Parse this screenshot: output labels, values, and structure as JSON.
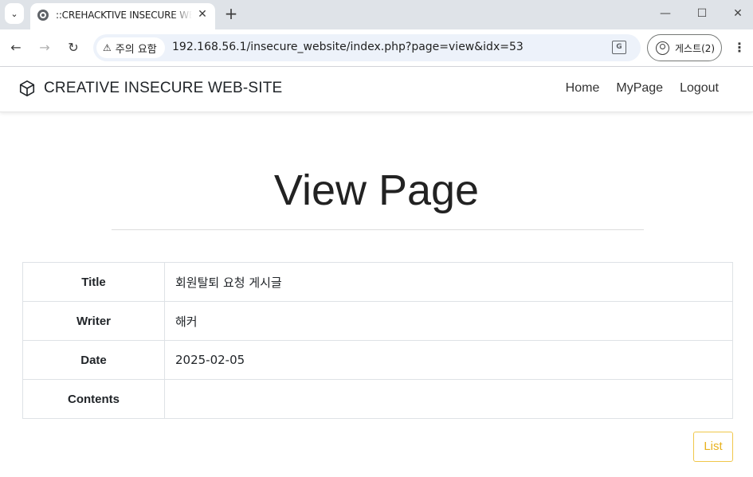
{
  "browser": {
    "tab_title": "::CREHACKTIVE INSECURE WEBSITE::",
    "new_tab_label": "+",
    "security_label": "주의 요함",
    "url": "192.168.56.1/insecure_website/index.php?page=view&idx=53",
    "profile_label": "게스트(2)",
    "icons": [
      "tab-search-icon",
      "globe-icon",
      "close-icon",
      "plus-icon",
      "minimize-icon",
      "maximize-icon",
      "window-close-icon",
      "back-icon",
      "forward-icon",
      "reload-icon",
      "warning-icon",
      "translate-icon",
      "person-icon",
      "more-vert-icon"
    ]
  },
  "site": {
    "brand": "CREATIVE INSECURE WEB-SITE",
    "nav": [
      {
        "label": "Home"
      },
      {
        "label": "MyPage"
      },
      {
        "label": "Logout"
      }
    ]
  },
  "main": {
    "title": "View Page",
    "rows": [
      {
        "label": "Title",
        "value": "회원탈퇴 요청 게시글"
      },
      {
        "label": "Writer",
        "value": "해커"
      },
      {
        "label": "Date",
        "value": "2025-02-05"
      },
      {
        "label": "Contents",
        "value": ""
      }
    ],
    "list_button": "List"
  },
  "colors": {
    "accent_warning": "#e8b21f",
    "tabstrip": "#dfe3e8",
    "omnibox": "#edf2fa"
  }
}
